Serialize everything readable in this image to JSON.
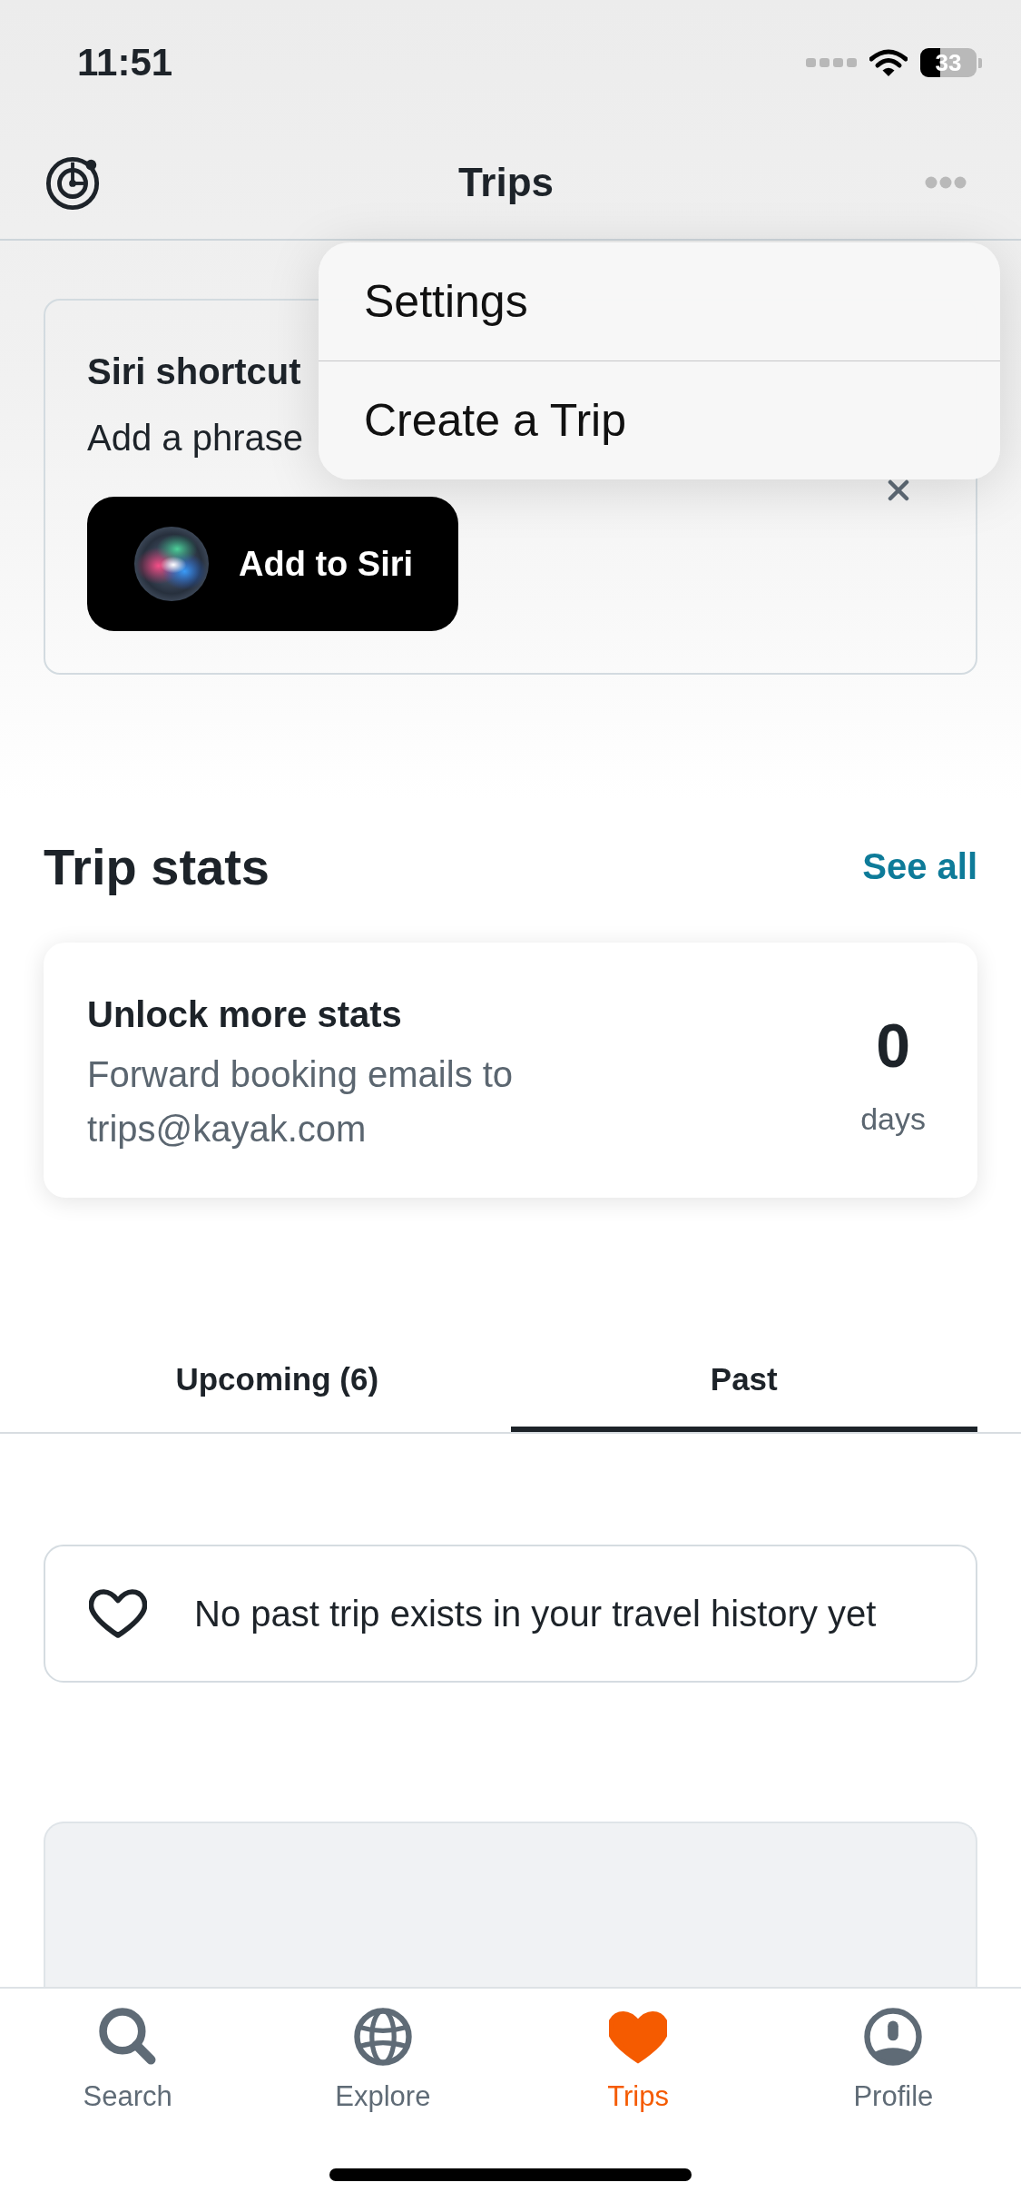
{
  "status_bar": {
    "time": "11:51",
    "battery": "33"
  },
  "nav_bar": {
    "title": "Trips"
  },
  "menu": {
    "items": [
      {
        "label": "Settings"
      },
      {
        "label": "Create a Trip"
      }
    ]
  },
  "siri_card": {
    "title": "Siri shortcut",
    "text": "Add a phrase",
    "button": "Add to Siri"
  },
  "trip_stats": {
    "heading": "Trip stats",
    "link": "See all",
    "card": {
      "title": "Unlock more stats",
      "text": "Forward booking emails to trips@kayak.com",
      "value": "0",
      "unit": "days"
    }
  },
  "trip_tabs": [
    {
      "label": "Upcoming (6)",
      "selected": false
    },
    {
      "label": "Past",
      "selected": true
    }
  ],
  "empty_state": {
    "text": "No past trip exists in your travel history yet"
  },
  "tab_bar": [
    {
      "label": "Search",
      "kind": "search",
      "selected": false
    },
    {
      "label": "Explore",
      "kind": "explore",
      "selected": false
    },
    {
      "label": "Trips",
      "kind": "trips",
      "selected": true
    },
    {
      "label": "Profile",
      "kind": "profile",
      "selected": false
    }
  ]
}
